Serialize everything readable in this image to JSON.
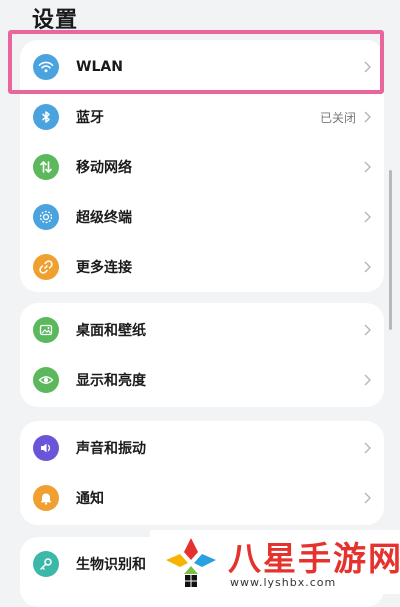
{
  "header": {
    "title": "设置"
  },
  "groups": [
    {
      "items": [
        {
          "label": "WLAN",
          "icon": "wifi-icon",
          "color": "#4aa3df",
          "value": ""
        },
        {
          "label": "蓝牙",
          "icon": "bluetooth-icon",
          "color": "#4aa3df",
          "value": "已关闭"
        },
        {
          "label": "移动网络",
          "icon": "mobile-data-icon",
          "color": "#5cb85c",
          "value": ""
        },
        {
          "label": "超级终端",
          "icon": "super-device-icon",
          "color": "#4aa3df",
          "value": ""
        },
        {
          "label": "更多连接",
          "icon": "more-connections-icon",
          "color": "#f0a030",
          "value": ""
        }
      ]
    },
    {
      "items": [
        {
          "label": "桌面和壁纸",
          "icon": "wallpaper-icon",
          "color": "#5cb85c",
          "value": ""
        },
        {
          "label": "显示和亮度",
          "icon": "display-eye-icon",
          "color": "#5cb85c",
          "value": ""
        }
      ]
    },
    {
      "items": [
        {
          "label": "声音和振动",
          "icon": "sound-icon",
          "color": "#6a55d8",
          "value": ""
        },
        {
          "label": "通知",
          "icon": "notification-bell-icon",
          "color": "#f0a030",
          "value": ""
        }
      ]
    },
    {
      "items": [
        {
          "label": "生物识别和",
          "icon": "key-icon",
          "color": "#3cb8a8",
          "value": ""
        }
      ]
    }
  ],
  "watermark": {
    "title": "八星手游网",
    "url": "www.lyshbx.com"
  },
  "colors": {
    "highlight": "#e8669c",
    "background": "#f1f3f5",
    "watermark_red": "#e5322d"
  }
}
